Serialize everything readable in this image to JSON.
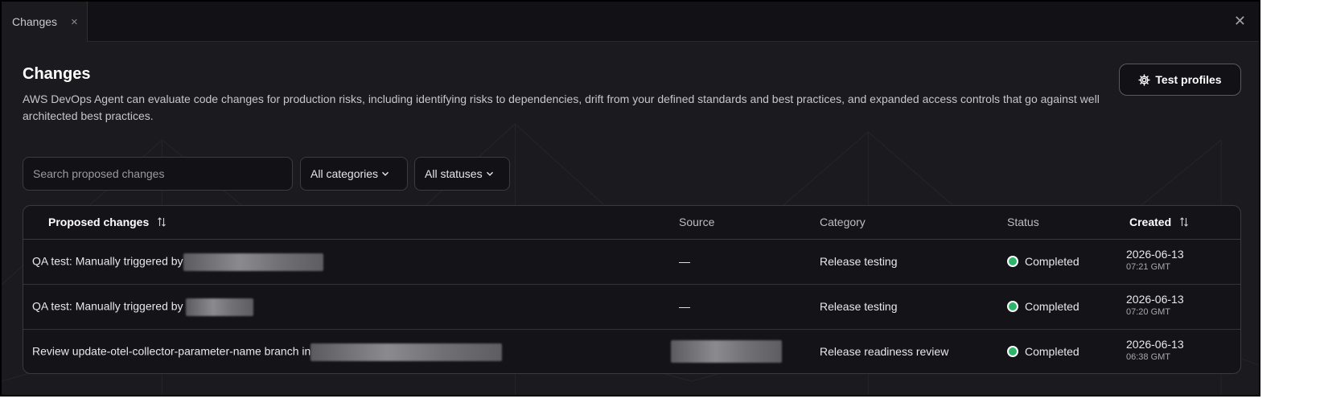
{
  "tab": {
    "label": "Changes",
    "close_glyph": "×"
  },
  "window": {
    "close_glyph": "✕"
  },
  "page": {
    "title": "Changes",
    "description": "AWS DevOps Agent can evaluate code changes for production risks, including identifying risks to dependencies, drift from your defined standards and best practices, and expanded access controls that go against well architected best practices."
  },
  "actions": {
    "test_profiles_label": "Test profiles",
    "test_profiles_icon": "gear-icon"
  },
  "filters": {
    "search_placeholder": "Search proposed changes",
    "category_selected": "All categories",
    "status_selected": "All statuses"
  },
  "table": {
    "columns": {
      "proposed": "Proposed changes",
      "source": "Source",
      "category": "Category",
      "status": "Status",
      "created": "Created"
    },
    "rows": [
      {
        "title": "QA test: Manually triggered by",
        "source": "—",
        "category": "Release testing",
        "status": "Completed",
        "date": "2026-06-13",
        "time": "07:21 GMT"
      },
      {
        "title": "QA test: Manually triggered by",
        "source": "—",
        "category": "Release testing",
        "status": "Completed",
        "date": "2026-06-13",
        "time": "07:20 GMT"
      },
      {
        "title": "Review update-otel-collector-parameter-name branch in",
        "source": "",
        "category": "Release readiness review",
        "status": "Completed",
        "date": "2026-06-13",
        "time": "06:38 GMT"
      }
    ]
  },
  "colors": {
    "status_completed": "#2fb36a",
    "background": "#1b1a1f"
  }
}
